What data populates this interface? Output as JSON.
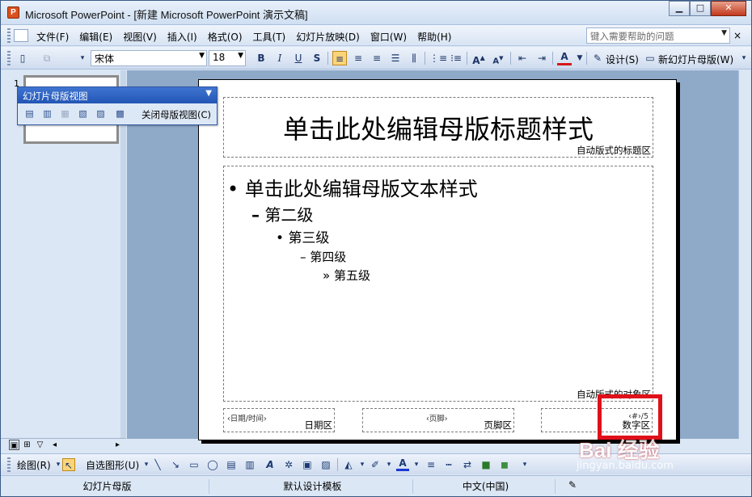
{
  "window": {
    "title": "Microsoft PowerPoint - [新建 Microsoft PowerPoint 演示文稿]",
    "app_icon": "P",
    "controls": {
      "minimize": "▁",
      "maximize": "□",
      "close": "✕"
    }
  },
  "menubar": {
    "items": [
      "文件(F)",
      "编辑(E)",
      "视图(V)",
      "插入(I)",
      "格式(O)",
      "工具(T)",
      "幻灯片放映(D)",
      "窗口(W)",
      "帮助(H)"
    ],
    "help_placeholder": "键入需要帮助的问题",
    "close": "×"
  },
  "toolbar": {
    "font_name": "宋体",
    "font_size": "18",
    "bold": "B",
    "italic": "I",
    "underline": "U",
    "shadow": "S",
    "design_label": "设计(S)",
    "new_master_label": "新幻灯片母版(W)"
  },
  "master_toolbar": {
    "title": "幻灯片母版视图",
    "close_label": "关闭母版视图(C)"
  },
  "slide": {
    "title": "单击此处编辑母版标题样式",
    "title_area_label": "自动版式的标题区",
    "body_levels": [
      "单击此处编辑母版文本样式",
      "第二级",
      "第三级",
      "第四级",
      "第五级"
    ],
    "bullets": [
      "•",
      "–",
      "•",
      "–",
      "»"
    ],
    "object_area_label": "自动版式的对象区",
    "date_tag": "‹日期/时间›",
    "date_label": "日期区",
    "footer_tag": "‹页脚›",
    "footer_label": "页脚区",
    "number_tag": "‹#›/5",
    "number_label": "数字区"
  },
  "thumbnail": {
    "number": "1"
  },
  "drawing_toolbar": {
    "draw_label": "绘图(R)",
    "autoshapes_label": "自选图形(U)"
  },
  "statusbar": {
    "view": "幻灯片母版",
    "template": "默认设计模板",
    "language": "中文(中国)"
  },
  "watermark": {
    "main": "Bai 经验",
    "sub": "jingyan.baidu.com"
  },
  "colors": {
    "highlight": "#e0101a",
    "accent": "#2356b4"
  }
}
